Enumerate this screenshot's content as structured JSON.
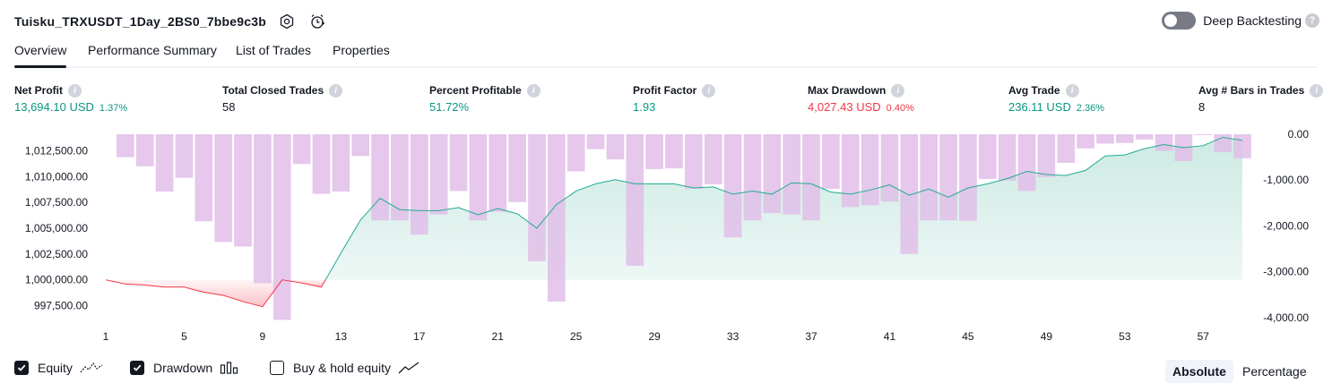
{
  "header": {
    "strategy_title": "Tuisku_TRXUSDT_1Day_2BS0_7bbe9c3b",
    "deep_backtesting_label": "Deep Backtesting",
    "help_glyph": "?"
  },
  "tabs": [
    {
      "label": "Overview",
      "active": true
    },
    {
      "label": "Performance Summary",
      "active": false
    },
    {
      "label": "List of Trades",
      "active": false
    },
    {
      "label": "Properties",
      "active": false
    }
  ],
  "metrics": [
    {
      "label": "Net Profit",
      "value": "13,694.10 USD",
      "sub": "1.37%",
      "tone": "pos"
    },
    {
      "label": "Total Closed Trades",
      "value": "58",
      "sub": "",
      "tone": "neutral"
    },
    {
      "label": "Percent Profitable",
      "value": "51.72%",
      "sub": "",
      "tone": "pos"
    },
    {
      "label": "Profit Factor",
      "value": "1.93",
      "sub": "",
      "tone": "pos"
    },
    {
      "label": "Max Drawdown",
      "value": "4,027.43 USD",
      "sub": "0.40%",
      "tone": "neg"
    },
    {
      "label": "Avg Trade",
      "value": "236.11 USD",
      "sub": "2.36%",
      "tone": "pos"
    },
    {
      "label": "Avg # Bars in Trades",
      "value": "8",
      "sub": "",
      "tone": "neutral"
    }
  ],
  "info_glyph": "i",
  "legend": {
    "equity_label": "Equity",
    "drawdown_label": "Drawdown",
    "buy_hold_label": "Buy & hold equity"
  },
  "modes": {
    "absolute_label": "Absolute",
    "percentage_label": "Percentage",
    "selected": "Absolute"
  },
  "colors": {
    "profit": "#089981",
    "loss": "#f23645",
    "drawdown_bar": "#e1bee7",
    "equity_fill": "#cdeae3",
    "equity_line_up": "#22ab94",
    "equity_line_down": "#f23645"
  },
  "chart_data": {
    "type": "line",
    "x_ticks": [
      "1",
      "5",
      "9",
      "13",
      "17",
      "21",
      "25",
      "29",
      "33",
      "37",
      "41",
      "45",
      "49",
      "53",
      "57"
    ],
    "left_axis": {
      "ticks": [
        "1,012,500.00",
        "1,010,000.00",
        "1,007,500.00",
        "1,005,000.00",
        "1,002,500.00",
        "1,000,000.00",
        "997,500.00"
      ],
      "range": [
        995900,
        1014100
      ]
    },
    "right_axis": {
      "ticks": [
        "0.00",
        "-1,000.00",
        "-2,000.00",
        "-3,000.00",
        "-4,000.00"
      ],
      "range": [
        -4100,
        0
      ]
    },
    "baseline": 1000000,
    "x": [
      1,
      2,
      3,
      4,
      5,
      6,
      7,
      8,
      9,
      10,
      11,
      12,
      13,
      14,
      15,
      16,
      17,
      18,
      19,
      20,
      21,
      22,
      23,
      24,
      25,
      26,
      27,
      28,
      29,
      30,
      31,
      32,
      33,
      34,
      35,
      36,
      37,
      38,
      39,
      40,
      41,
      42,
      43,
      44,
      45,
      46,
      47,
      48,
      49,
      50,
      51,
      52,
      53,
      54,
      55,
      56,
      57,
      58,
      59
    ],
    "series": [
      {
        "values": [
          1000000,
          999600,
          999500,
          999300,
          999300,
          998800,
          998500,
          997900,
          997400,
          1000000,
          999700,
          999300,
          1002600,
          1005800,
          1007900,
          1006800,
          1006700,
          1006700,
          1007000,
          1006300,
          1006900,
          1006400,
          1005000,
          1007300,
          1008600,
          1009300,
          1009700,
          1009300,
          1009300,
          1009300,
          1008900,
          1009000,
          1008300,
          1008600,
          1008300,
          1009400,
          1009300,
          1008500,
          1008300,
          1008700,
          1009200,
          1008200,
          1008800,
          1008000,
          1008900,
          1009300,
          1009800,
          1010500,
          1010200,
          1010100,
          1010600,
          1012000,
          1012100,
          1012700,
          1013100,
          1012800,
          1013000,
          1013800,
          1013500
        ]
      }
    ],
    "drawdown": [
      0,
      -500,
      -700,
      -1250,
      -950,
      -1900,
      -2350,
      -2450,
      -3250,
      -4050,
      -650,
      -1300,
      -1250,
      -475,
      -1880,
      -1880,
      -2190,
      -1750,
      -1240,
      -1880,
      -1690,
      -1480,
      -2770,
      -3650,
      -810,
      -325,
      -550,
      -2870,
      -760,
      -745,
      -1190,
      -1090,
      -2250,
      -1880,
      -1720,
      -1750,
      -1880,
      -1190,
      -1590,
      -1550,
      -1470,
      -2610,
      -1880,
      -1880,
      -1890,
      -975,
      -1010,
      -1235,
      -935,
      -625,
      -310,
      -205,
      -190,
      -115,
      -360,
      -585,
      -20,
      -390,
      -525
    ],
    "equity_ylim": [
      995900,
      1014100
    ],
    "drawdown_ylim": [
      -4100,
      0
    ]
  }
}
